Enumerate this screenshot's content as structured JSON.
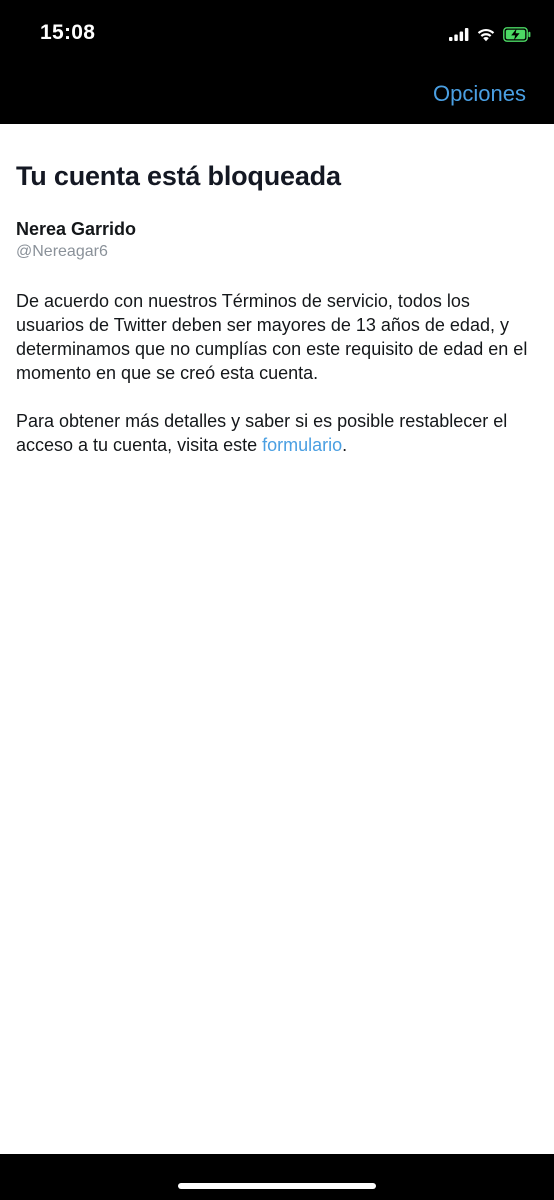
{
  "status_bar": {
    "time": "15:08",
    "icons": [
      "signal-icon",
      "wifi-icon",
      "battery-charging-icon"
    ],
    "battery_color": "#4cd964"
  },
  "nav": {
    "options_label": "Opciones"
  },
  "page": {
    "title": "Tu cuenta está bloqueada",
    "user_name": "Nerea Garrido",
    "user_handle": "@Nereagar6",
    "paragraph_1": "De acuerdo con nuestros Términos de servicio, todos los usuarios de Twitter deben ser mayores de 13 años de edad, y determinamos que no cumplías con este requisito de edad en el momento en que se creó esta cuenta.",
    "paragraph_2_before_link": "Para obtener más detalles y saber si es posible restablecer el acceso a tu cuenta, visita este ",
    "paragraph_2_link": "formulario",
    "paragraph_2_after_link": "."
  },
  "colors": {
    "link": "#4a9fe2",
    "text": "#14171a",
    "secondary_text": "#8a9199",
    "bars": "#000000"
  }
}
